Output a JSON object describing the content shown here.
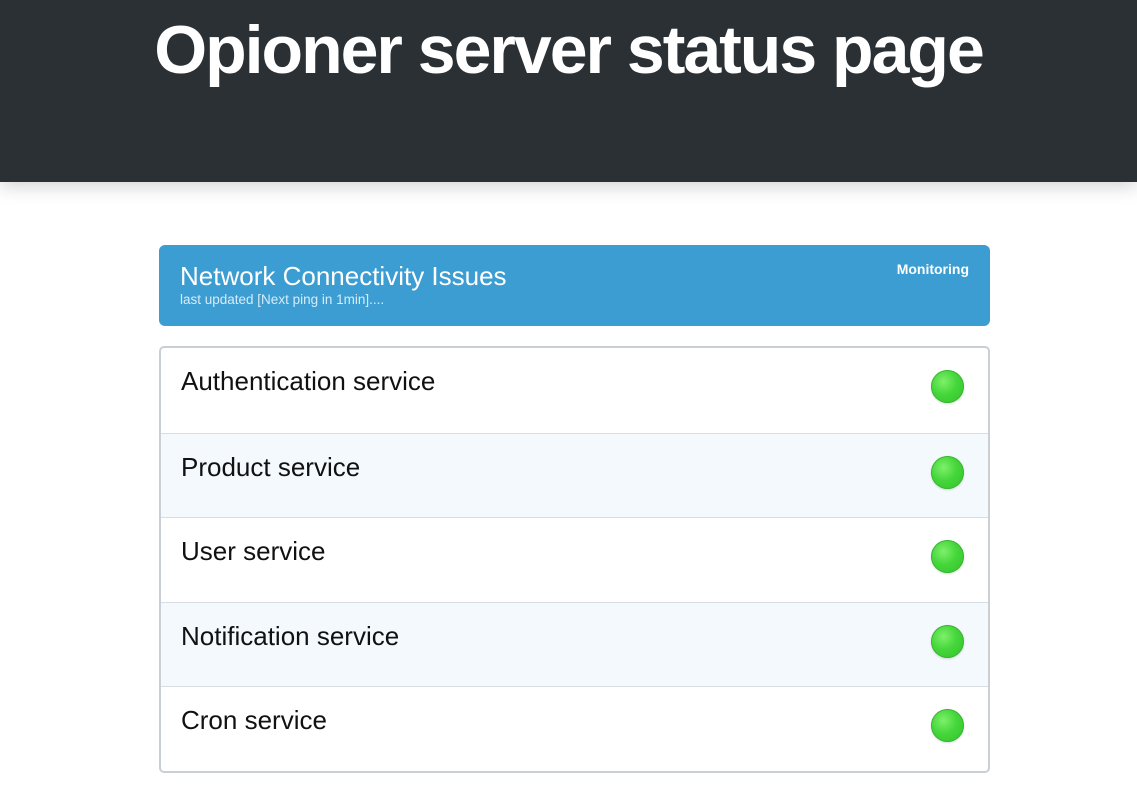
{
  "header": {
    "title": "Opioner server status page"
  },
  "incident": {
    "title": "Network Connectivity Issues",
    "updated": "last updated [Next ping in 1min]....",
    "status": "Monitoring"
  },
  "services": [
    {
      "name": "Authentication service",
      "status": "operational",
      "status_color": "#44d63a"
    },
    {
      "name": "Product service",
      "status": "operational",
      "status_color": "#44d63a"
    },
    {
      "name": "User service",
      "status": "operational",
      "status_color": "#44d63a"
    },
    {
      "name": "Notification service",
      "status": "operational",
      "status_color": "#44d63a"
    },
    {
      "name": "Cron service",
      "status": "operational",
      "status_color": "#44d63a"
    }
  ],
  "colors": {
    "header_bg": "#2b3035",
    "incident_bg": "#3b9dd2",
    "status_ok": "#44d63a"
  }
}
